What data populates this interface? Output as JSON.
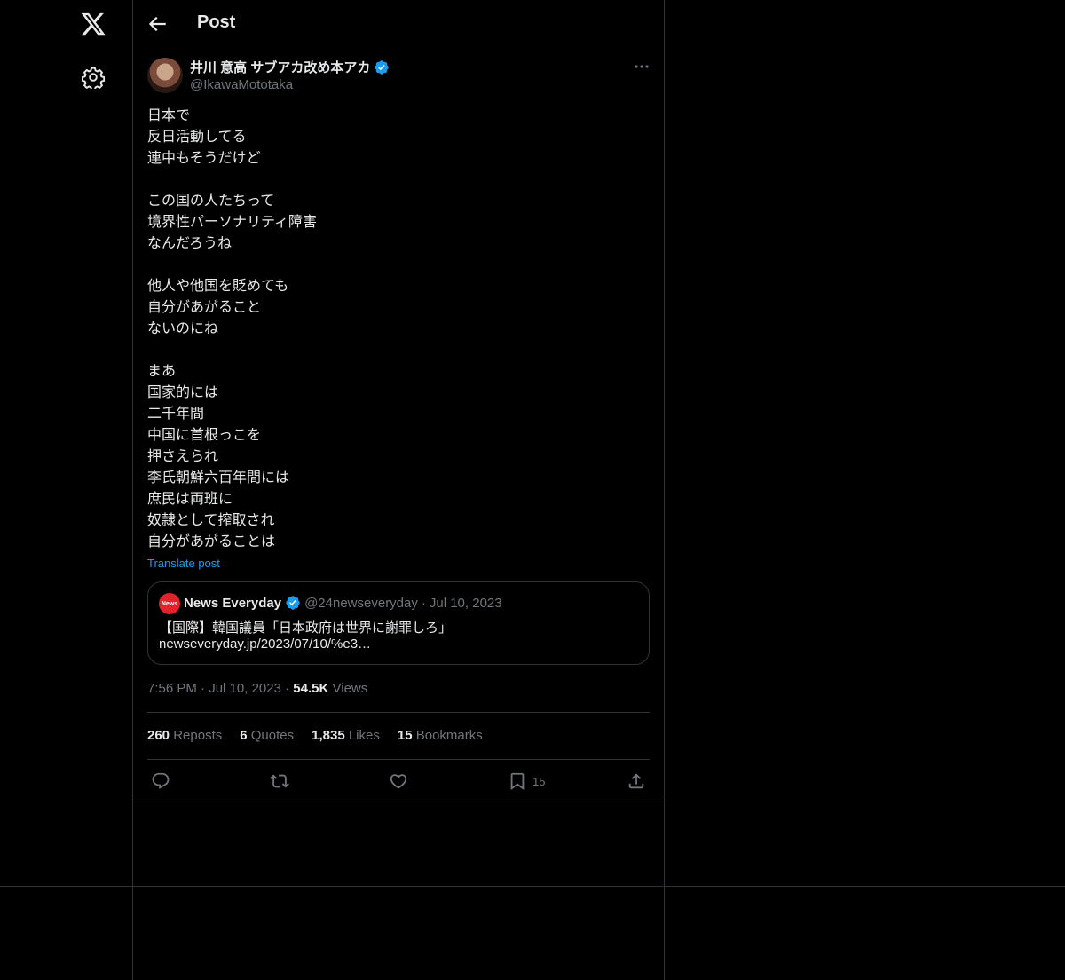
{
  "nav": {
    "logo_icon": "x-logo-icon",
    "settings_icon": "gear-icon"
  },
  "header": {
    "title": "Post",
    "back_icon": "arrow-left-icon"
  },
  "post": {
    "author": {
      "name": "井川 意高 サブアカ改め本アカ",
      "handle": "@IkawaMototaka",
      "verified": true,
      "verified_color": "#1d9bf0"
    },
    "text_lines": [
      "日本で",
      "反日活動してる",
      "連中もそうだけど",
      "",
      "この国の人たちって",
      "境界性パーソナリティ障害",
      "なんだろうね",
      "",
      "他人や他国を貶めても",
      "自分があがること",
      "ないのにね",
      "",
      "まあ",
      "国家的には",
      "二千年間",
      "中国に首根っこを",
      "押さえられ",
      "李氏朝鮮六百年間には",
      "庶民は両班に",
      "奴隷として搾取され",
      "自分があがることは"
    ],
    "translate_label": "Translate post",
    "quote": {
      "avatar_text": "News",
      "name": "News Everyday",
      "handle": "@24newseveryday",
      "separator": "·",
      "date": "Jul 10, 2023",
      "line1": "【国際】韓国議員「日本政府は世界に謝罪しろ」",
      "line2": "newseveryday.jp/2023/07/10/%e3…"
    },
    "time": "7:56 PM",
    "date": "Jul 10, 2023",
    "dot": "·",
    "views_count": "54.5K",
    "views_label": "Views",
    "stats": {
      "reposts_count": "260",
      "reposts_label": "Reposts",
      "quotes_count": "6",
      "quotes_label": "Quotes",
      "likes_count": "1,835",
      "likes_label": "Likes",
      "bookmarks_count": "15",
      "bookmarks_label": "Bookmarks"
    },
    "actions": {
      "reply_icon": "reply-icon",
      "repost_icon": "repost-icon",
      "like_icon": "heart-icon",
      "bookmark_icon": "bookmark-icon",
      "bookmark_count": "15",
      "share_icon": "share-icon"
    }
  },
  "colors": {
    "background": "#000000",
    "text": "#e7e9ea",
    "secondary_text": "#71767b",
    "border": "#2f3336",
    "accent": "#1d9bf0"
  }
}
